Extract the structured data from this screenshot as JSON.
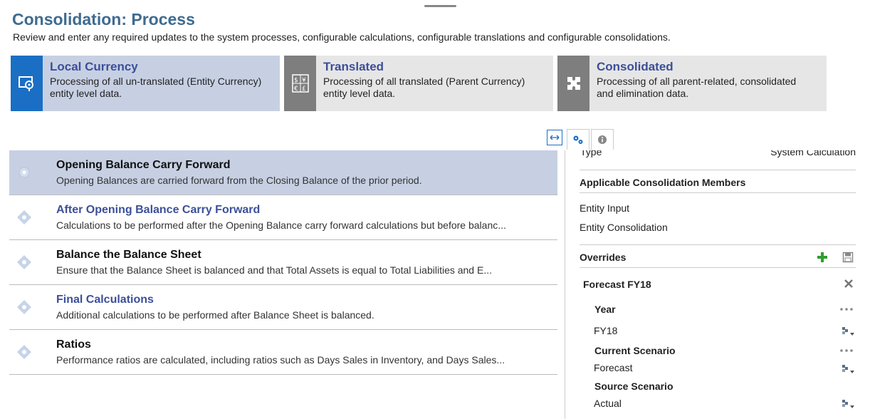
{
  "page": {
    "title": "Consolidation: Process",
    "description": "Review and enter any required updates to the system processes, configurable calculations, configurable translations and configurable consolidations."
  },
  "cards": [
    {
      "title": "Local Currency",
      "desc1": "Processing of all un-translated (Entity Currency)",
      "desc2": "entity level data.",
      "icon": "map-pin-icon"
    },
    {
      "title": "Translated",
      "desc1": "Processing of all translated (Parent Currency)",
      "desc2": "entity level data.",
      "icon": "currency-exchange-icon"
    },
    {
      "title": "Consolidated",
      "desc1": "Processing of all parent-related, consolidated",
      "desc2": "and elimination data.",
      "icon": "puzzle-icon"
    }
  ],
  "list": [
    {
      "title": "Opening Balance Carry Forward",
      "desc": "Opening Balances are carried forward from the Closing Balance of the prior period."
    },
    {
      "title": "After Opening Balance Carry Forward",
      "desc": "Calculations to be performed after the Opening Balance carry forward calculations but before balanc..."
    },
    {
      "title": "Balance the Balance Sheet",
      "desc": "Ensure that the Balance Sheet is balanced and that Total Assets is equal to Total Liabilities and E..."
    },
    {
      "title": "Final Calculations",
      "desc": "Additional calculations to be performed after Balance Sheet is balanced."
    },
    {
      "title": "Ratios",
      "desc": "Performance ratios are calculated, including ratios such as Days Sales in Inventory, and Days Sales..."
    }
  ],
  "panel": {
    "type_label": "Type",
    "type_value": "System Calculation",
    "members_header": "Applicable Consolidation Members",
    "members": [
      "Entity Input",
      "Entity Consolidation"
    ],
    "overrides_header": "Overrides",
    "override_name": "Forecast FY18",
    "year_label": "Year",
    "year_value": "FY18",
    "current_scenario_label": "Current Scenario",
    "current_scenario_value": "Forecast",
    "source_scenario_label": "Source Scenario",
    "source_scenario_value": "Actual"
  },
  "colors": {
    "accent": "#1a6fc4",
    "title": "#3f6b8f",
    "link": "#3c4f9a",
    "selected": "#c7d0e3",
    "add": "#2e9e2e"
  }
}
